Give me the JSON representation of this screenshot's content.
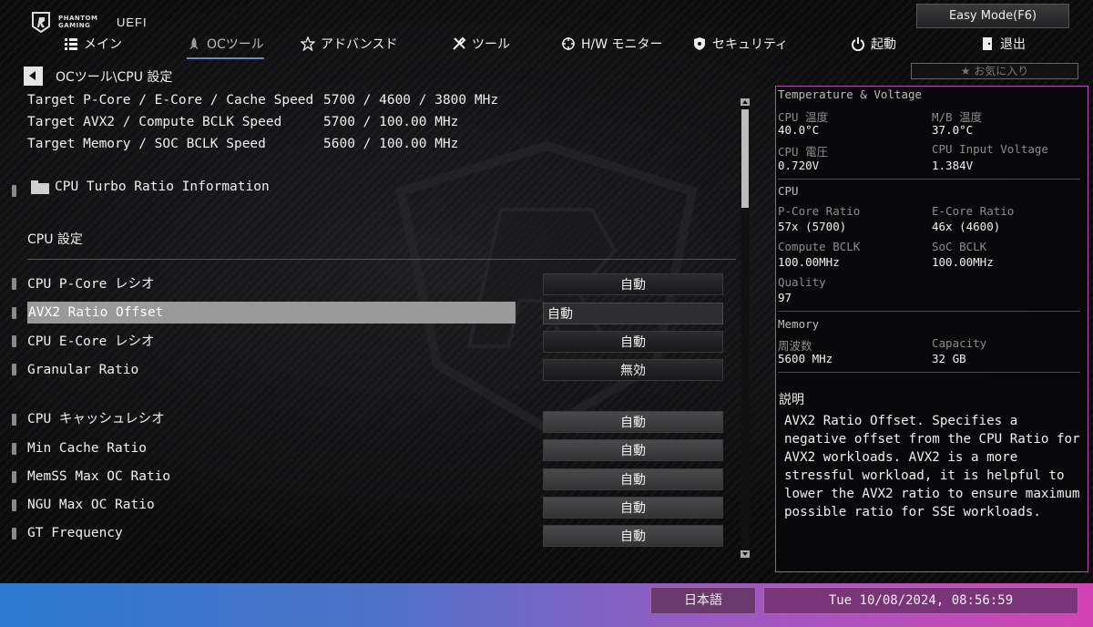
{
  "header": {
    "brand_line1": "PHANTOM",
    "brand_line2": "GAMING",
    "uefi": "UEFI",
    "easy_mode": "Easy Mode(F6)",
    "favorites": "★ お気に入り"
  },
  "nav": [
    {
      "label": "メイン",
      "icon": "list-icon"
    },
    {
      "label": "OCツール",
      "icon": "rocket-icon",
      "active": true
    },
    {
      "label": "アドバンスド",
      "icon": "star-icon"
    },
    {
      "label": "ツール",
      "icon": "tools-icon"
    },
    {
      "label": "H/W モニター",
      "icon": "crosshair-icon"
    },
    {
      "label": "セキュリティ",
      "icon": "shield-icon"
    },
    {
      "label": "起動",
      "icon": "power-icon"
    },
    {
      "label": "退出",
      "icon": "exit-door-icon"
    }
  ],
  "breadcrumb": "OCツール\\CPU 設定",
  "info": [
    {
      "label": "Target P-Core / E-Core / Cache Speed",
      "value": "5700 / 4600 / 3800 MHz"
    },
    {
      "label": "Target AVX2 / Compute BCLK Speed",
      "value": "5700 / 100.00 MHz"
    },
    {
      "label": "Target Memory / SOC BCLK Speed",
      "value": "5600 / 100.00 MHz"
    }
  ],
  "folder_label": "CPU Turbo Ratio Information",
  "section_title": "CPU 設定",
  "settings": [
    {
      "label": "CPU P-Core レシオ",
      "value": "自動"
    },
    {
      "label": "AVX2 Ratio Offset",
      "value": "自動"
    },
    {
      "label": "CPU E-Core レシオ",
      "value": "自動"
    },
    {
      "label": "Granular Ratio",
      "value": "無効"
    },
    {
      "label": "CPU  キャッシュレシオ",
      "value": "自動"
    },
    {
      "label": "Min Cache  Ratio",
      "value": "自動"
    },
    {
      "label": "MemSS Max OC Ratio",
      "value": "自動"
    },
    {
      "label": "NGU Max OC Ratio",
      "value": "自動"
    },
    {
      "label": "GT Frequency",
      "value": "自動"
    }
  ],
  "panel": {
    "tv_title": "Temperature & Voltage",
    "cpu_temp_label": "CPU 温度",
    "cpu_temp": "40.0°C",
    "mb_temp_label": "M/B 温度",
    "mb_temp": "37.0°C",
    "cpu_volt_label": "CPU 電圧",
    "cpu_volt": "0.720V",
    "cpu_input_label": "CPU Input Voltage",
    "cpu_input": "1.384V",
    "cpu_title": "CPU",
    "pcore_label": "P-Core Ratio",
    "pcore": "57x (5700)",
    "ecore_label": "E-Core Ratio",
    "ecore": "46x (4600)",
    "cbclk_label": "Compute BCLK",
    "cbclk": "100.00MHz",
    "socbclk_label": "SoC BCLK",
    "socbclk": "100.00MHz",
    "quality_label": "Quality",
    "quality": "97",
    "mem_title": "Memory",
    "freq_label": "周波数",
    "freq": "5600 MHz",
    "cap_label": "Capacity",
    "cap": "32 GB",
    "desc_title": "説明",
    "desc_text": "AVX2 Ratio Offset. Specifies a negative offset from the CPU Ratio for AVX2 workloads. AVX2 is a more stressful workload, it is helpful to lower the AVX2 ratio to ensure maximum possible ratio for SSE workloads."
  },
  "footer": {
    "language": "日本語",
    "datetime": "Tue 10/08/2024, 08:56:59"
  },
  "colors": {
    "panel_border": "#b24fb0",
    "nav_active_underline": "#6b86c9",
    "footer_left": "#2b79d0",
    "footer_right": "#d442b4"
  }
}
